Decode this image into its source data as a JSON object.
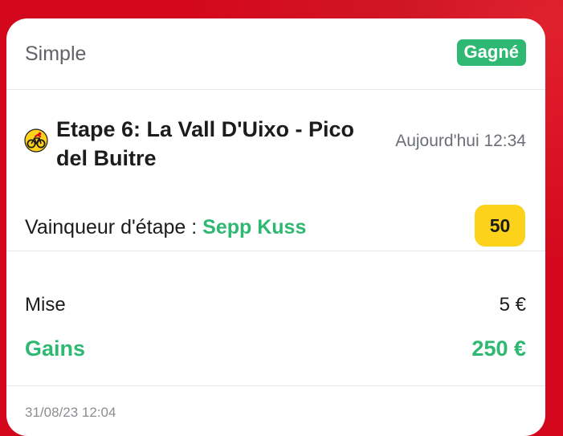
{
  "bet": {
    "type": "Simple",
    "status": "Gagné",
    "event_title": "Etape 6: La Vall D'Uixo - Pico del Buitre",
    "event_time": "Aujourd'hui 12:34",
    "market_label": "Vainqueur d'étape : ",
    "selection": "Sepp Kuss",
    "odds": "50",
    "stake_label": "Mise",
    "stake_value": "5 €",
    "gains_label": "Gains",
    "gains_value": "250 €",
    "placed_date": "31/08/23 12:04",
    "sport_icon": "cycling-icon"
  },
  "colors": {
    "background": "#d3081c",
    "win_green": "#2eb872",
    "odds_yellow": "#fcd21a"
  }
}
